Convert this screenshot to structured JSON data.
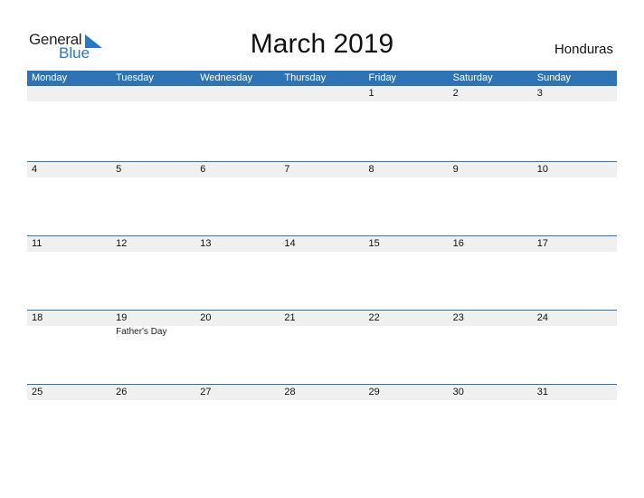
{
  "brand": {
    "part1": "General",
    "part2": "Blue"
  },
  "title": "March 2019",
  "country": "Honduras",
  "colors": {
    "accent": "#2e74b5",
    "band": "#f0f0f0"
  },
  "weekdays": [
    "Monday",
    "Tuesday",
    "Wednesday",
    "Thursday",
    "Friday",
    "Saturday",
    "Sunday"
  ],
  "weeks": [
    [
      "",
      "",
      "",
      "",
      "1",
      "2",
      "3"
    ],
    [
      "4",
      "5",
      "6",
      "7",
      "8",
      "9",
      "10"
    ],
    [
      "11",
      "12",
      "13",
      "14",
      "15",
      "16",
      "17"
    ],
    [
      "18",
      "19",
      "20",
      "21",
      "22",
      "23",
      "24"
    ],
    [
      "25",
      "26",
      "27",
      "28",
      "29",
      "30",
      "31"
    ]
  ],
  "events": [
    {
      "week": 3,
      "day": 1,
      "label": "Father's Day"
    }
  ]
}
